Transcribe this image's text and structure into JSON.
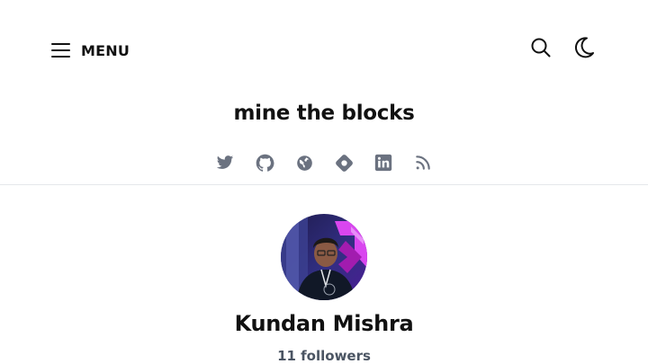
{
  "header": {
    "menu_label": "MENU",
    "menu_icon": "hamburger-icon",
    "search_icon": "search-icon",
    "theme_icon": "moon-icon"
  },
  "blog": {
    "title": "mine the blocks"
  },
  "social_links": [
    {
      "icon": "twitter-icon"
    },
    {
      "icon": "github-icon"
    },
    {
      "icon": "globe-icon"
    },
    {
      "icon": "hashnode-icon"
    },
    {
      "icon": "linkedin-icon"
    },
    {
      "icon": "rss-icon"
    }
  ],
  "author": {
    "name": "Kundan Mishra",
    "followers": "11 followers"
  },
  "colors": {
    "text": "#111111",
    "icon_gray": "#6b7280",
    "followers_text": "#4b5563",
    "divider": "#e5e7eb",
    "avatar_accent": "#d946ef"
  }
}
